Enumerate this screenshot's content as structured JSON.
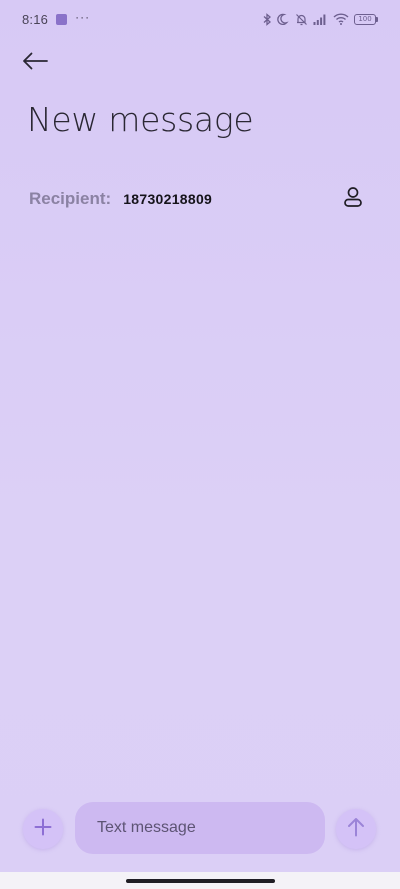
{
  "status_bar": {
    "time": "8:16",
    "overflow": "···",
    "battery": "100",
    "icons": [
      "notification-square-icon",
      "bluetooth-icon",
      "moon-icon",
      "bell-off-icon",
      "signal-icon",
      "wifi-icon",
      "battery-icon"
    ]
  },
  "header": {
    "back_icon": "arrow-left-icon",
    "title": "New message"
  },
  "recipient": {
    "label": "Recipient:",
    "value": "18730218809",
    "contact_icon": "person-icon"
  },
  "composer": {
    "add_icon": "plus-icon",
    "placeholder": "Text message",
    "send_icon": "arrow-up-icon"
  },
  "colors": {
    "background": "#d9ccf5",
    "accent": "#8a72c9",
    "button_bg": "#d4c2f7",
    "field_bg": "#cdb9f1"
  }
}
